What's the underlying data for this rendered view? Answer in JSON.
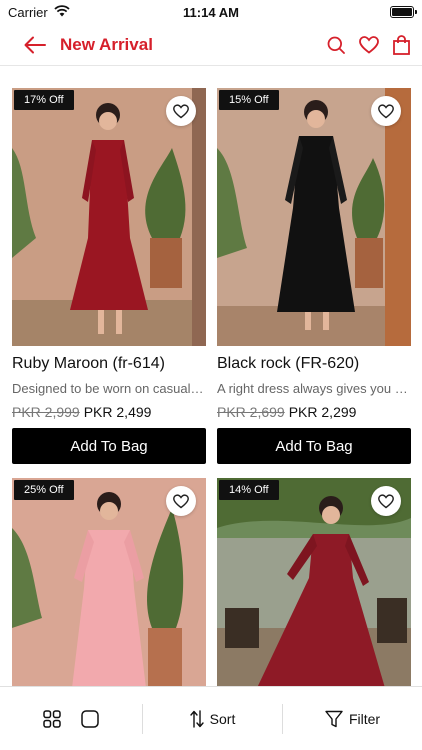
{
  "status_bar": {
    "carrier": "Carrier",
    "time": "11:14 AM"
  },
  "header": {
    "title": "New Arrival",
    "back_icon": "arrow-left-icon",
    "icons": [
      "search-icon",
      "heart-icon",
      "bag-icon"
    ]
  },
  "colors": {
    "accent": "#d6202b",
    "button": "#000000",
    "badge": "#111111"
  },
  "products": [
    {
      "badge": "17% Off",
      "name": "Ruby Maroon (fr-614)",
      "description": "Designed to be worn on casual days...",
      "old_price": "PKR 2,999",
      "new_price": "PKR 2,499",
      "button": "Add To Bag",
      "dress_color": "#9a1622"
    },
    {
      "badge": "15% Off",
      "name": "Black rock (FR-620)",
      "description": "A right dress always gives you confidence",
      "old_price": "PKR 2,699",
      "new_price": "PKR 2,299",
      "button": "Add To Bag",
      "dress_color": "#111111"
    },
    {
      "badge": "25% Off",
      "dress_color": "#f2a9ad"
    },
    {
      "badge": "14% Off",
      "dress_color": "#8e1a26"
    }
  ],
  "bottom_bar": {
    "sort_label": "Sort",
    "filter_label": "Filter"
  }
}
